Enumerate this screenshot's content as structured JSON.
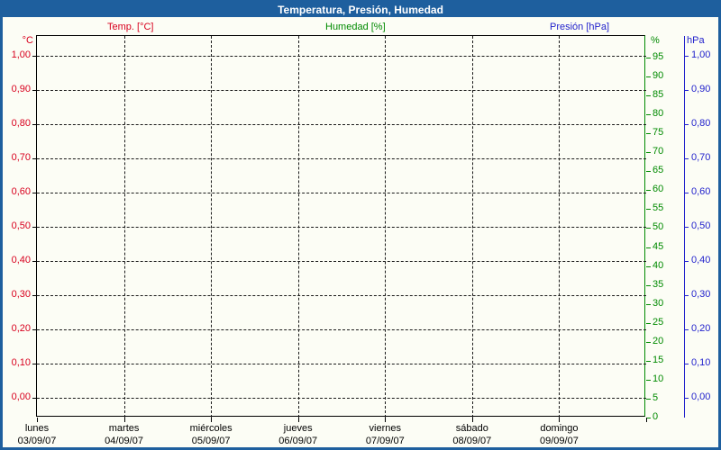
{
  "window": {
    "title": "Temperatura, Presión, Humedad"
  },
  "legend": {
    "temperature": "Temp. [°C]",
    "humidity": "Humedad [%]",
    "pressure": "Presión [hPa]"
  },
  "colors": {
    "titlebar": "#1e5f9e",
    "panel_background": "#fcfdf5",
    "temperature": "#d8001e",
    "humidity": "#008a00",
    "pressure": "#2222cc",
    "grid": "#1a1a1a"
  },
  "chart_data": {
    "type": "line",
    "title": "Temperatura, Presión, Humedad",
    "grid": "dashed",
    "x_days": [
      "lunes",
      "martes",
      "miércoles",
      "jueves",
      "viernes",
      "sábado",
      "domingo"
    ],
    "x_dates": [
      "03/09/07",
      "04/09/07",
      "05/09/07",
      "06/09/07",
      "07/09/07",
      "08/09/07",
      "09/09/07"
    ],
    "y_axes": {
      "temperature": {
        "unit": "°C",
        "side": "left",
        "tick_labels": [
          "1,00",
          "0,90",
          "0,80",
          "0,70",
          "0,60",
          "0,50",
          "0,40",
          "0,30",
          "0,20",
          "0,10",
          "0,00"
        ],
        "ylim": [
          0.0,
          1.0
        ]
      },
      "humidity": {
        "unit": "%",
        "side": "right-inner",
        "tick_labels": [
          "95",
          "90",
          "85",
          "80",
          "75",
          "70",
          "65",
          "60",
          "55",
          "50",
          "45",
          "40",
          "35",
          "30",
          "25",
          "20",
          "15",
          "10",
          "5",
          "0"
        ],
        "ylim": [
          0,
          100
        ]
      },
      "pressure": {
        "unit": "hPa",
        "side": "right-outer",
        "tick_labels": [
          "1,00",
          "0,90",
          "0,80",
          "0,70",
          "0,60",
          "0,50",
          "0,40",
          "0,30",
          "0,20",
          "0,10",
          "0,00"
        ],
        "ylim": [
          0.0,
          1.0
        ]
      }
    },
    "series": [
      {
        "name": "Temp. [°C]",
        "axis": "temperature",
        "values": []
      },
      {
        "name": "Humedad [%]",
        "axis": "humidity",
        "values": []
      },
      {
        "name": "Presión [hPa]",
        "axis": "pressure",
        "values": []
      }
    ],
    "plotted_points": "none — chart area is empty, no data drawn"
  }
}
